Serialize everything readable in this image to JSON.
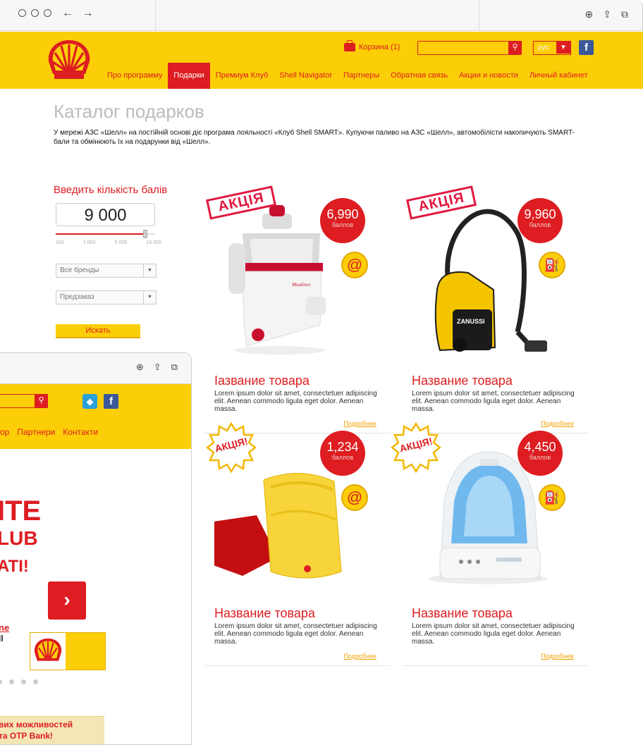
{
  "browser_back": {
    "nav_glyph": "← →",
    "tool_icons": [
      "download-icon",
      "share-icon",
      "tabs-icon"
    ]
  },
  "header": {
    "cart_label": "Корзина (1)",
    "search_placeholder": "",
    "language": "рус",
    "facebook": "f",
    "menu": [
      {
        "label": "Про программу",
        "active": false
      },
      {
        "label": "Подарки",
        "active": true
      },
      {
        "label": "Премиум Клуб",
        "active": false
      },
      {
        "label": "Shell Navigator",
        "active": false
      },
      {
        "label": "Партнеры",
        "active": false
      },
      {
        "label": "Обратная связь",
        "active": false
      },
      {
        "label": "Акции и новости",
        "active": false
      },
      {
        "label": "Личный кабинет",
        "active": false
      }
    ]
  },
  "page": {
    "title": "Каталог подарков",
    "intro": "У мережі АЗС «Шелл» на постійній основі діє програма лояльності «Клуб Shell SMART». Купуючи паливо на АЗС «Шелл», автомобілісти накопичують SMART-бали та обмінюють їх на подарунки від «Шелл»."
  },
  "filter": {
    "title": "Введить кількість балів",
    "points": "9 000",
    "slider_value": 9000,
    "slider_max": 10000,
    "ticks": [
      "100",
      "1 000",
      "5 000",
      "10 000"
    ],
    "brand_select": "Все бренды",
    "preorder_select": "Предзаказ",
    "button": "Искать"
  },
  "products": [
    {
      "name": "Iазвание товара",
      "desc": "Lorem ipsum dolor sit amet, consectetuer adipiscing elit. Aenean commodo ligula eget dolor. Aenean massa.",
      "price": "6,990",
      "unit": "баллов",
      "promo": "АКЦІЯ",
      "promo_style": "stamp",
      "type_icon": "at-icon",
      "type_glyph": "@",
      "more": "Подробнее",
      "image": "juicer"
    },
    {
      "name": "Название товара",
      "desc": "Lorem ipsum dolor sit amet, consectetuer adipiscing elit. Aenean commodo ligula eget dolor. Aenean massa.",
      "price": "9,960",
      "unit": "баллов",
      "promo": "АКЦІЯ",
      "promo_style": "stamp",
      "type_icon": "fuel-pump-icon",
      "type_glyph": "⛽",
      "more": "Подробнее",
      "image": "vacuum",
      "image_label": "ZANUSSI"
    },
    {
      "name": "Название товара",
      "desc": "Lorem ipsum dolor sit amet, consectetuer adipiscing elit. Aenean commodo ligula eget dolor. Aenean massa.",
      "price": "1,234",
      "unit": "баллов",
      "promo": "АКЦІЯ!",
      "promo_style": "burst",
      "type_icon": "at-icon",
      "type_glyph": "@",
      "more": "Подробнее",
      "image": "towels"
    },
    {
      "name": "Название товара",
      "desc": "Lorem ipsum dolor sit amet, consectetuer adipiscing elit. Aenean commodo ligula eget dolor. Aenean massa.",
      "price": "4,450",
      "unit": "баллов",
      "promo": "АКЦІЯ!",
      "promo_style": "burst",
      "type_icon": "fuel-pump-icon",
      "type_glyph": "⛽",
      "more": "Подробнее",
      "image": "humidifier"
    }
  ],
  "front_window": {
    "menu": [
      "ор",
      "Партнери",
      "Контакти"
    ],
    "hero_line_1": "ITE",
    "hero_line_2": "LUB",
    "hero_line_3": "ATI!",
    "hero_link": "ne",
    "hero_small": "ll",
    "next_glyph": "›",
    "promo_line_1": "вих можливостей",
    "promo_line_2": "та OTP Bank!"
  },
  "colors": {
    "shell_yellow": "#fbce07",
    "shell_red": "#dd1d21"
  }
}
